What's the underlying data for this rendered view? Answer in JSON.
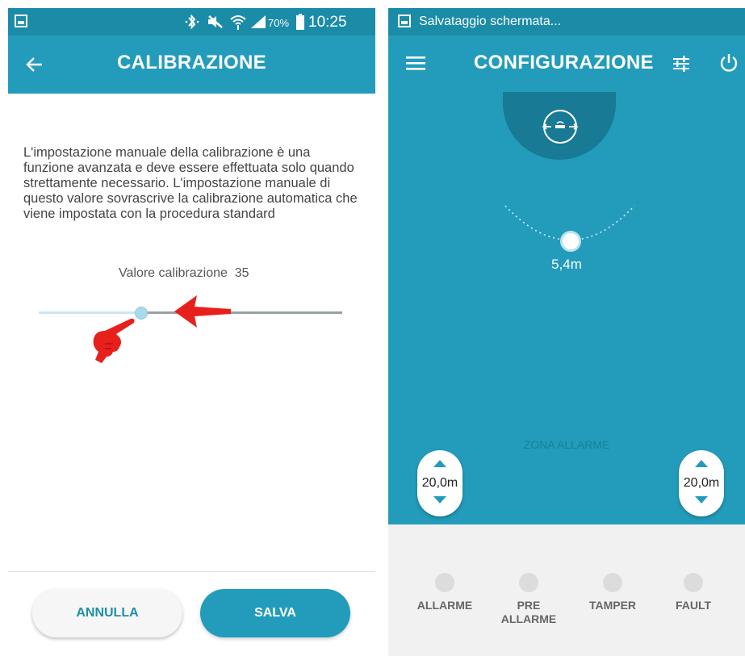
{
  "left_screen": {
    "status": {
      "battery": "70%",
      "time": "10:25"
    },
    "title": "CALIBRAZIONE",
    "description": "L'impostazione manuale della calibrazione è una funzione avanzata e deve essere effettuata solo quando strettamente necessario. L'impostazione manuale di questo valore sovrascrive la calibrazione automatica che viene impostata con la procedura standard",
    "calibration_label": "Valore calibrazione",
    "calibration_value": "35",
    "slider_fraction": 0.33,
    "cancel_label": "ANNULLA",
    "save_label": "SALVA"
  },
  "right_screen": {
    "status": {
      "notification": "Salvataggio schermata..."
    },
    "title": "CONFIGURAZIONE",
    "distance_label": "5,4m",
    "zone_label": "ZONA ALLARME",
    "left_stepper_value": "20,0m",
    "right_stepper_value": "20,0m",
    "indicators": [
      {
        "line1": "ALLARME",
        "line2": ""
      },
      {
        "line1": "PRE",
        "line2": "ALLARME"
      },
      {
        "line1": "TAMPER",
        "line2": ""
      },
      {
        "line1": "FAULT",
        "line2": ""
      }
    ]
  },
  "colors": {
    "primary": "#239cbb",
    "dark_primary": "#187a94",
    "annotation_red": "#e8201c"
  }
}
